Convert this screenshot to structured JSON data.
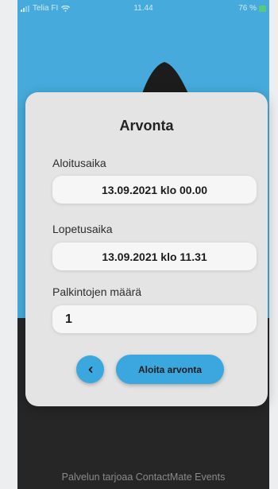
{
  "status_bar": {
    "carrier": "Telia FI",
    "time": "11.44",
    "battery": "76 %"
  },
  "colors": {
    "accent": "#3aa7de",
    "sky": "#46abdc",
    "ground": "#262626",
    "card": "#e4e4e4"
  },
  "dialog": {
    "title": "Arvonta",
    "start_label": "Aloitusaika",
    "start_value": "13.09.2021 klo 00.00",
    "end_label": "Lopetusaika",
    "end_value": "13.09.2021 klo 11.31",
    "prizes_label": "Palkintojen määrä",
    "prizes_value": "1",
    "back_icon": "chevron-left-icon",
    "start_button": "Aloita arvonta"
  },
  "footer": "Palvelun tarjoaa ContactMate Events"
}
